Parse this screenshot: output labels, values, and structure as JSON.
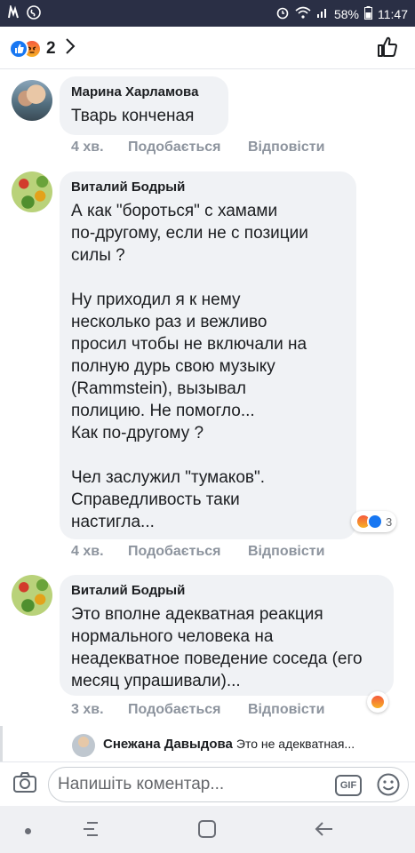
{
  "status_bar": {
    "battery": "58%",
    "time": "11:47",
    "icons": [
      "notification-icon",
      "shazam-icon",
      "alarm-icon",
      "wifi-icon",
      "signal-icon",
      "battery-icon"
    ]
  },
  "reactions_header": {
    "count": "2",
    "icons": [
      "like-reaction-icon",
      "angry-reaction-icon"
    ]
  },
  "comments": [
    {
      "author": "Марина Харламова",
      "text": "Тварь конченая",
      "time": "4 хв.",
      "like_label": "Подобається",
      "reply_label": "Відповісти"
    },
    {
      "author": "Виталий Бодрый",
      "text": "А как \"бороться\" с хамами\nпо-другому, если не с позиции\nсилы ?\n\nНу приходил я к нему\nнесколько раз и вежливо\nпросил чтобы не включали на\nполную дурь свою музыку\n(Rammstein), вызывал\nполицию. Не помогло...\nКак по-другому ?\n\nЧел заслужил \"тумаков\".\nСправедливость таки\nнастигла...",
      "time": "4 хв.",
      "like_label": "Подобається",
      "reply_label": "Відповісти",
      "reaction_count": "3"
    },
    {
      "author": "Виталий Бодрый",
      "text": "Это вполне адекватная реакция\nнормального человека на\nнеадекватное поведение соседа (его\nмесяц упрашивали)...",
      "time": "3 хв.",
      "like_label": "Подобається",
      "reply_label": "Відповісти"
    }
  ],
  "reply_preview": {
    "author": "Снежана Давыдова",
    "text": "Это не адекватная..."
  },
  "composer": {
    "placeholder": "Напишіть коментар...",
    "gif_label": "GIF"
  }
}
